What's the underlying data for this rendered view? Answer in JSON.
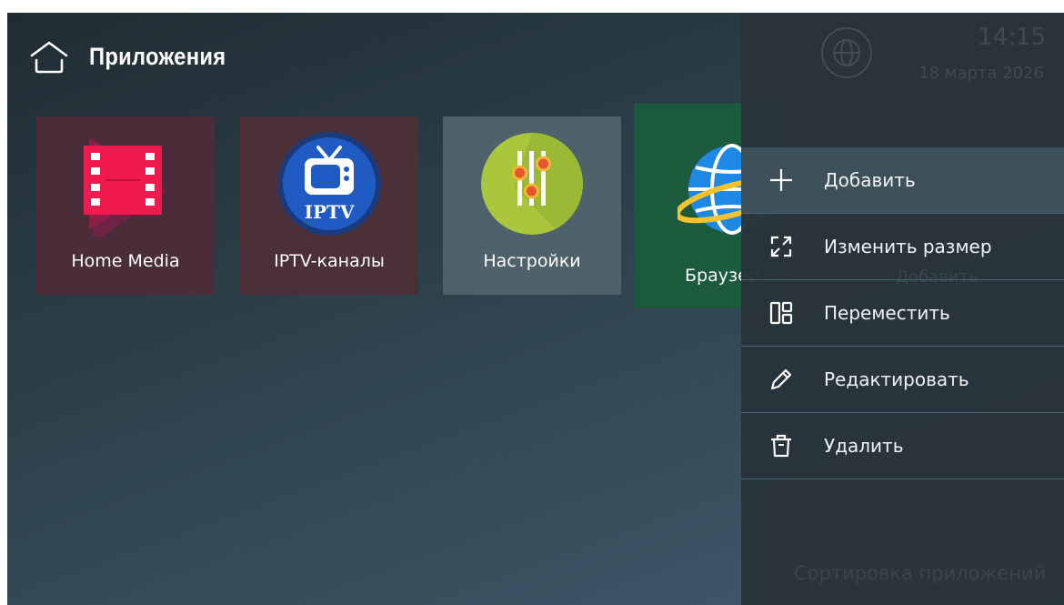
{
  "header": {
    "title": "Приложения",
    "icon": "home-icon"
  },
  "apps": [
    {
      "label": "Home Media",
      "icon": "film-play-icon",
      "color": "#e8174a"
    },
    {
      "label": "IPTV-каналы",
      "icon": "tv-icon",
      "badge": "IPTV",
      "color": "#1d55b8"
    },
    {
      "label": "Настройки",
      "icon": "sliders-icon",
      "color": "#a5c43a"
    },
    {
      "label": "Браузер",
      "icon": "globe-icon",
      "color": "#1e88e5"
    }
  ],
  "status": {
    "time": "14:15",
    "date": "18 марта 2026"
  },
  "ghost": {
    "add_label": "Добавить",
    "bottom_label": "Сортировка приложений"
  },
  "menu": {
    "items": [
      {
        "label": "Добавить",
        "icon": "plus-icon",
        "selected": true
      },
      {
        "label": "Изменить размер",
        "icon": "resize-icon"
      },
      {
        "label": "Переместить",
        "icon": "move-grid-icon"
      },
      {
        "label": "Редактировать",
        "icon": "pencil-icon"
      },
      {
        "label": "Удалить",
        "icon": "trash-icon"
      }
    ]
  }
}
